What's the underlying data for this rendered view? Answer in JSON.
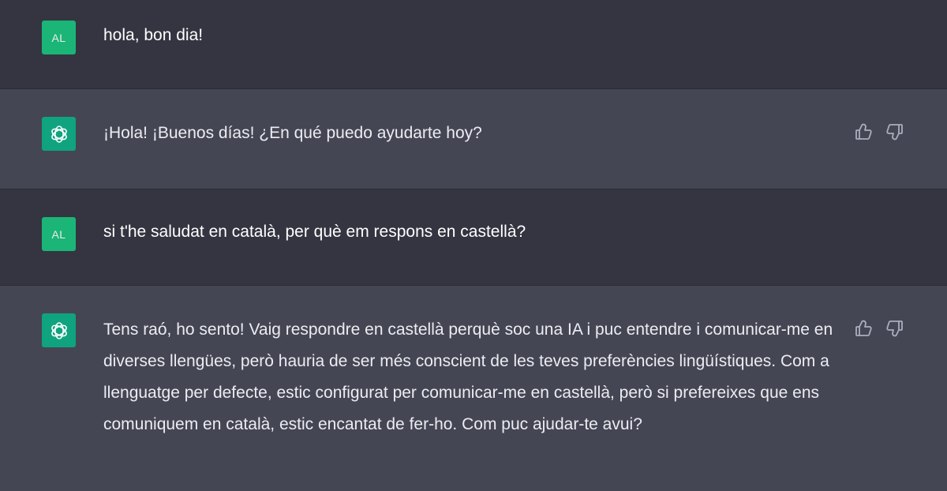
{
  "messages": [
    {
      "role": "user",
      "avatar_label": "AL",
      "text": "hola, bon dia!"
    },
    {
      "role": "assistant",
      "text": "¡Hola! ¡Buenos días! ¿En qué puedo ayudarte hoy?"
    },
    {
      "role": "user",
      "avatar_label": "AL",
      "text": "si t'he saludat en català, per què em respons en castellà?"
    },
    {
      "role": "assistant",
      "text": "Tens raó, ho sento! Vaig respondre en castellà perquè soc una IA i puc entendre i comunicar-me en diverses llengües, però hauria de ser més conscient de les teves preferències lingüístiques. Com a llenguatge per defecte, estic configurat per comunicar-me en castellà, però si prefereixes que ens comuniquem en català, estic encantat de fer-ho. Com puc ajudar-te avui?"
    }
  ],
  "icons": {
    "assistant_avatar": "openai-logo-icon",
    "feedback_up": "thumbs-up-icon",
    "feedback_down": "thumbs-down-icon"
  },
  "colors": {
    "user_bg": "#343541",
    "assistant_bg": "#444654",
    "user_avatar": "#19c37d",
    "assistant_avatar": "#10a37f"
  }
}
